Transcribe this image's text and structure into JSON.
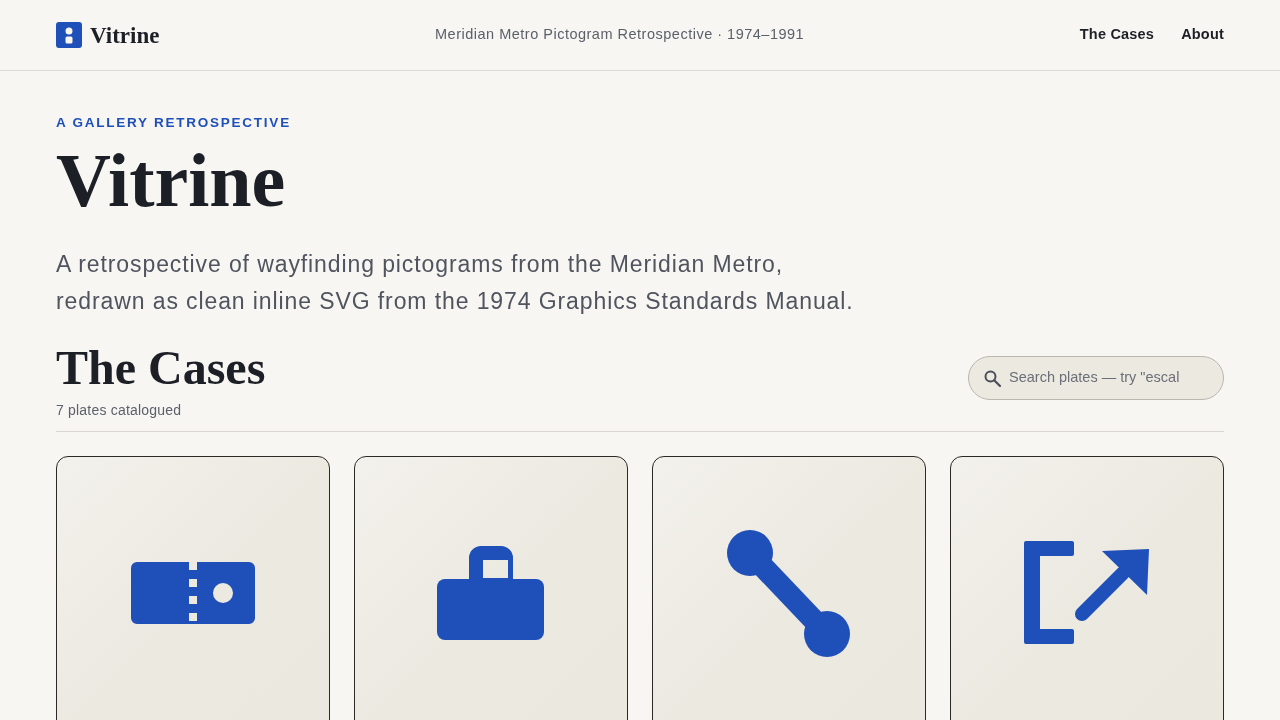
{
  "header": {
    "brand": "Vitrine",
    "subtitle": "Meridian Metro Pictogram Retrospective · 1974–1991",
    "nav": [
      "The Cases",
      "About"
    ]
  },
  "hero": {
    "eyebrow": "A GALLERY RETROSPECTIVE",
    "title": "Vitrine",
    "lead": "A retrospective of wayfinding pictograms from the Meridian Metro, redrawn as clean inline SVG from the 1974 Graphics Standards Manual."
  },
  "cases": {
    "heading": "The Cases",
    "count": "7 plates catalogued",
    "search": {
      "placeholder": "Search plates — try \"escal"
    },
    "plates": [
      {
        "kind": "ticket"
      },
      {
        "kind": "luggage"
      },
      {
        "kind": "connector"
      },
      {
        "kind": "exit"
      }
    ]
  }
}
